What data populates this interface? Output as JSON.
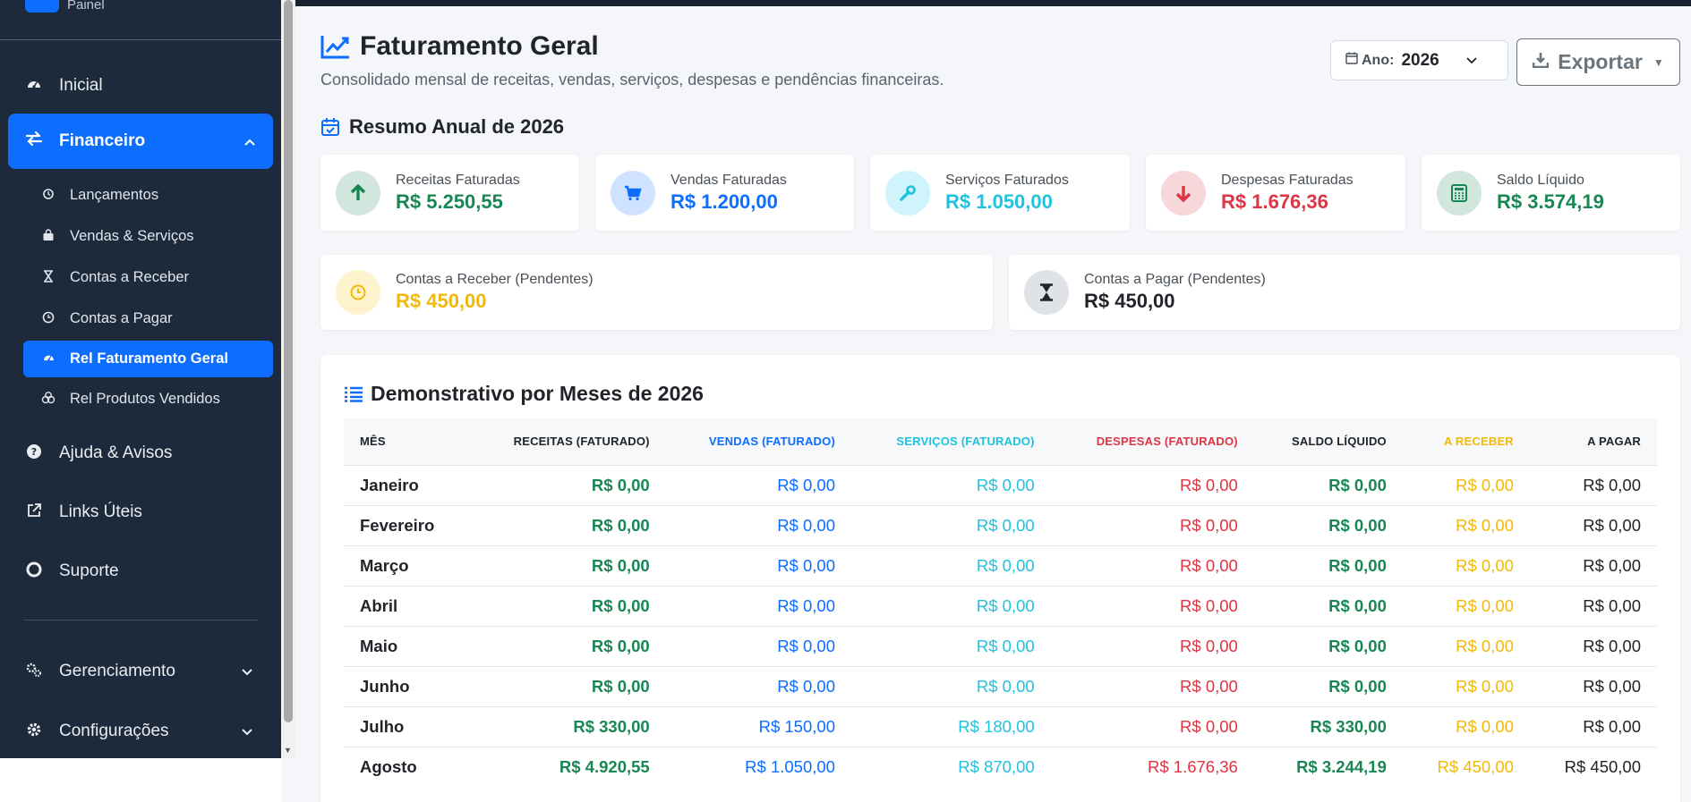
{
  "sidebar": {
    "brand_text": "Painel",
    "items": [
      {
        "label": "Inicial"
      },
      {
        "label": "Financeiro"
      },
      {
        "label": "Ajuda & Avisos"
      },
      {
        "label": "Links Úteis"
      },
      {
        "label": "Suporte"
      },
      {
        "label": "Gerenciamento"
      },
      {
        "label": "Configurações"
      }
    ],
    "sub_items": [
      {
        "label": "Lançamentos"
      },
      {
        "label": "Vendas & Serviços"
      },
      {
        "label": "Contas a Receber"
      },
      {
        "label": "Contas a Pagar"
      },
      {
        "label": "Rel Faturamento Geral"
      },
      {
        "label": "Rel Produtos Vendidos"
      }
    ]
  },
  "header": {
    "title": "Faturamento Geral",
    "subtitle": "Consolidado mensal de receitas, vendas, serviços, despesas e pendências financeiras.",
    "year_label": "Ano:",
    "year_value": "2026",
    "export_label": "Exportar"
  },
  "summary": {
    "title": "Resumo Anual de 2026",
    "cards": [
      {
        "label": "Receitas Faturadas",
        "value": "R$ 5.250,55"
      },
      {
        "label": "Vendas Faturadas",
        "value": "R$ 1.200,00"
      },
      {
        "label": "Serviços Faturados",
        "value": "R$ 1.050,00"
      },
      {
        "label": "Despesas Faturadas",
        "value": "R$ 1.676,36"
      },
      {
        "label": "Saldo Líquido",
        "value": "R$ 3.574,19"
      },
      {
        "label": "Contas a Receber (Pendentes)",
        "value": "R$ 450,00"
      },
      {
        "label": "Contas a Pagar (Pendentes)",
        "value": "R$ 450,00"
      }
    ]
  },
  "table": {
    "title": "Demonstrativo por Meses de 2026",
    "headers": [
      "MÊS",
      "RECEITAS (FATURADO)",
      "VENDAS (FATURADO)",
      "SERVIÇOS (FATURADO)",
      "DESPESAS (FATURADO)",
      "SALDO LÍQUIDO",
      "A RECEBER",
      "A PAGAR"
    ],
    "rows": [
      [
        "Janeiro",
        "R$ 0,00",
        "R$ 0,00",
        "R$ 0,00",
        "R$ 0,00",
        "R$ 0,00",
        "R$ 0,00",
        "R$ 0,00"
      ],
      [
        "Fevereiro",
        "R$ 0,00",
        "R$ 0,00",
        "R$ 0,00",
        "R$ 0,00",
        "R$ 0,00",
        "R$ 0,00",
        "R$ 0,00"
      ],
      [
        "Março",
        "R$ 0,00",
        "R$ 0,00",
        "R$ 0,00",
        "R$ 0,00",
        "R$ 0,00",
        "R$ 0,00",
        "R$ 0,00"
      ],
      [
        "Abril",
        "R$ 0,00",
        "R$ 0,00",
        "R$ 0,00",
        "R$ 0,00",
        "R$ 0,00",
        "R$ 0,00",
        "R$ 0,00"
      ],
      [
        "Maio",
        "R$ 0,00",
        "R$ 0,00",
        "R$ 0,00",
        "R$ 0,00",
        "R$ 0,00",
        "R$ 0,00",
        "R$ 0,00"
      ],
      [
        "Junho",
        "R$ 0,00",
        "R$ 0,00",
        "R$ 0,00",
        "R$ 0,00",
        "R$ 0,00",
        "R$ 0,00",
        "R$ 0,00"
      ],
      [
        "Julho",
        "R$ 330,00",
        "R$ 150,00",
        "R$ 180,00",
        "R$ 0,00",
        "R$ 330,00",
        "R$ 0,00",
        "R$ 0,00"
      ],
      [
        "Agosto",
        "R$ 4.920,55",
        "R$ 1.050,00",
        "R$ 870,00",
        "R$ 1.676,36",
        "R$ 3.244,19",
        "R$ 450,00",
        "R$ 450,00"
      ]
    ]
  },
  "colors": {
    "primary": "#0d6efd",
    "sidebar_bg": "#1d2a3b",
    "green": "#198754",
    "cyan": "#1ec3e0",
    "red": "#dc3545",
    "yellow": "#f1b90a"
  }
}
